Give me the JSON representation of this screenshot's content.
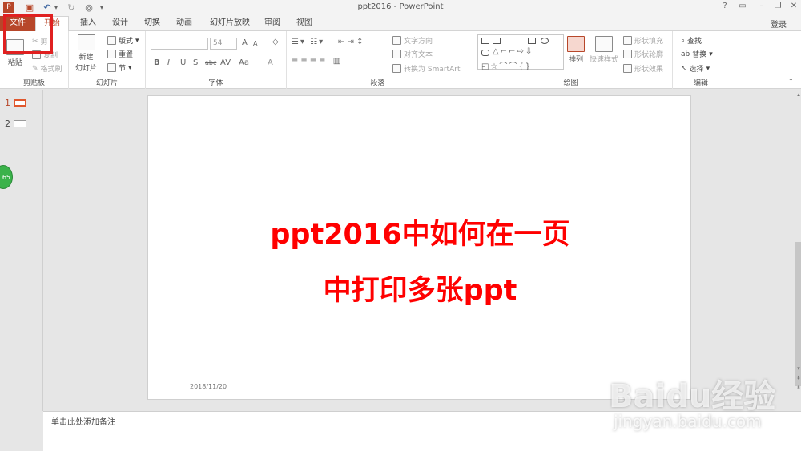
{
  "app": {
    "title": "ppt2016 - PowerPoint",
    "login": "登录",
    "window_controls": [
      "?",
      "▭",
      "–",
      "❐",
      "✕"
    ]
  },
  "tabs": [
    {
      "label": "文件"
    },
    {
      "label": "开始"
    },
    {
      "label": "插入"
    },
    {
      "label": "设计"
    },
    {
      "label": "切换"
    },
    {
      "label": "动画"
    },
    {
      "label": "幻灯片放映"
    },
    {
      "label": "审阅"
    },
    {
      "label": "视图"
    }
  ],
  "ribbon": {
    "clipboard": {
      "label": "剪贴板",
      "paste": "粘贴",
      "cut": "剪",
      "copy": "复制",
      "format_painter": "格式刷"
    },
    "slides": {
      "label": "幻灯片",
      "new_slide_1": "新建",
      "new_slide_2": "幻灯片",
      "layout": "版式",
      "reset": "重置",
      "section": "节"
    },
    "font": {
      "label": "字体",
      "font_name": "",
      "font_size": "54",
      "bold": "B",
      "italic": "I",
      "underline": "U",
      "shadow": "S",
      "strike": "abc",
      "spacing": "AV",
      "case": "Aa",
      "grow": "A",
      "shrink": "A",
      "color": "A"
    },
    "paragraph": {
      "label": "段落",
      "text_direction": "文字方向",
      "align_text": "对齐文本",
      "smartart": "转换为 SmartArt"
    },
    "drawing": {
      "label": "绘图",
      "arrange": "排列",
      "quick_styles": "快速样式",
      "shape_fill": "形状填充",
      "shape_outline": "形状轮廓",
      "shape_effects": "形状效果"
    },
    "editing": {
      "label": "编辑",
      "find": "查找",
      "replace": "替换",
      "select": "选择"
    }
  },
  "thumbnails": [
    {
      "number": "1"
    },
    {
      "number": "2"
    }
  ],
  "badge_text": "65",
  "slide": {
    "line1": "ppt2016中如何在一页",
    "line2": "中打印多张ppt",
    "date": "2018/11/20"
  },
  "notes": {
    "placeholder": "单击此处添加备注"
  },
  "watermark": {
    "logo": "Baidu经验",
    "url": "jingyan.baidu.com"
  },
  "colors": {
    "accent": "#b7472a",
    "slide_text": "#ff0000",
    "highlight": "#e02020"
  }
}
